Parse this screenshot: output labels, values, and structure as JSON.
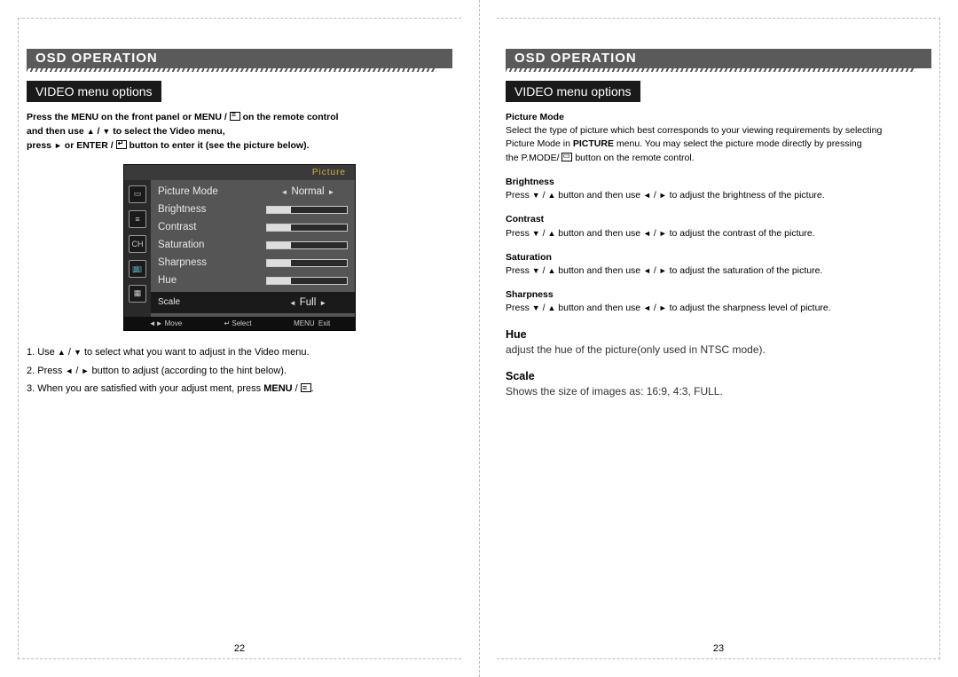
{
  "left": {
    "banner": "OSD OPERATION",
    "subhead": "VIDEO menu options",
    "intro": {
      "l1a": "Press the MENU on the front  panel or MENU",
      "l1b": " on the remote control",
      "l2a": "and then use ",
      "l2b": "  to select the  Video menu,",
      "l3a": "press  ",
      "l3b": "  or ENTER",
      "l3c": " button to enter it (see the picture below)",
      "up": "▲",
      "down": "▼",
      "right": "►",
      "slash": " / "
    },
    "osd": {
      "title": "Picture",
      "rows": {
        "picture_mode": "Picture  Mode",
        "picture_mode_value": "Normal",
        "brightness": "Brightness",
        "contrast": "Contrast",
        "saturation": "Saturation",
        "sharpness": "Sharpness",
        "hue": "Hue",
        "scale": "Scale",
        "scale_value": "Full"
      },
      "foot": {
        "move": "Move",
        "select": "Select",
        "exit": "Exit",
        "move_sym": "◄►",
        "select_sym": "↵",
        "exit_sym": "MENU"
      }
    },
    "steps": {
      "s1a": "1. Use  ",
      "s1b": "  to select what you want to adjust in the Video menu.",
      "s2a": "2. Press ",
      "s2b": "  button to adjust (according to  the hint below).",
      "s3a": "3. When you are satisfied with your adjust  ment, press  ",
      "s3b": "MENU",
      "up": "▲",
      "down": "▼",
      "left_t": "◄",
      "right_t": "►",
      "slash": " / "
    },
    "pagenum": "22"
  },
  "right": {
    "banner": "OSD OPERATION",
    "subhead": "VIDEO menu options",
    "defs": {
      "pm_h": "Picture Mode",
      "pm_b1": "Select the type of picture which best corresponds to your viewing requirements by selecting",
      "pm_b2a": "Picture Mode in ",
      "pm_b2b": "PICTURE",
      "pm_b2c": "  menu. You may select the picture mode directly by pressing",
      "pm_b3a": "the P.MODE/ ",
      "pm_b3b": " button on the remote  control.",
      "br_h": "Brightness",
      "br_b_pre": "Press  ",
      "br_b_post": "  to adjust the brightness of the picture.",
      "co_h": "Contrast",
      "co_b_pre": "Press  ",
      "co_b_post": " to adjust the contrast of the picture.",
      "sa_h": "Saturation",
      "sa_b_pre": "Press  ",
      "sa_b_post": " to adjust the saturation of the picture.",
      "sh_h": "Sharpness",
      "sh_b_pre": "Press ",
      "sh_b_post": "   to adjust the sharpness level of picture.",
      "hue_h": "Hue",
      "hue_b": "adjust the hue of the picture(only used in NTSC mode).",
      "scale_h": "Scale",
      "scale_b": "Shows the size of images as: 16:9, 4:3, FULL.",
      "mid": " button and then use  ",
      "down": "▼",
      "up": "▲",
      "left_t": "◄",
      "right_t": "►",
      "slash": " / "
    },
    "pagenum": "23"
  }
}
